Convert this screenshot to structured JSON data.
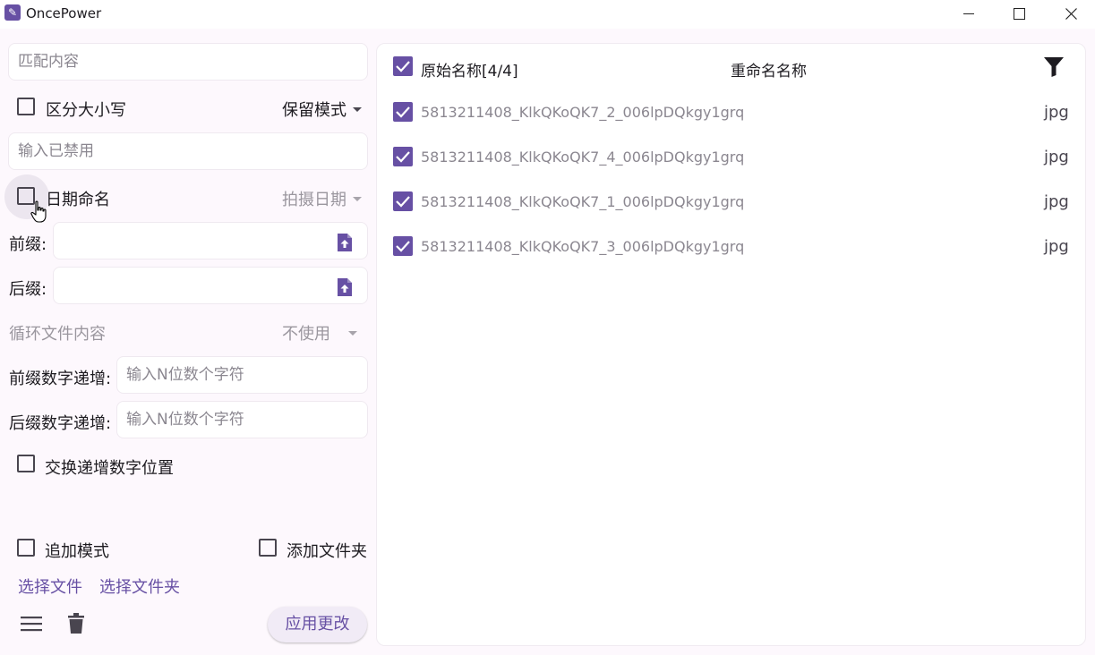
{
  "window": {
    "title": "OncePower"
  },
  "left": {
    "match_placeholder": "匹配内容",
    "case_sensitive_label": "区分大小写",
    "case_sensitive_checked": false,
    "mode_dropdown": "保留模式",
    "input_disabled_placeholder": "输入已禁用",
    "date_rename_label": "日期命名",
    "date_rename_checked": false,
    "date_dropdown": "拍摄日期",
    "prefix_label": "前缀:",
    "suffix_label": "后缀:",
    "loop_file_label": "循环文件内容",
    "loop_dropdown": "不使用",
    "prefix_increment_label": "前缀数字递增:",
    "prefix_increment_placeholder": "输入N位数个字符",
    "suffix_increment_label": "后缀数字递增:",
    "suffix_increment_placeholder": "输入N位数个字符",
    "swap_label": "交换递增数字位置",
    "append_mode_label": "追加模式",
    "add_folder_label": "添加文件夹",
    "select_files_link": "选择文件",
    "select_folder_link": "选择文件夹",
    "apply_button": "应用更改"
  },
  "right": {
    "header_original": "原始名称[4/4]",
    "header_rename": "重命名名称",
    "files": [
      {
        "name": "5813211408_KlkQKoQK7_2_006lpDQkgy1grq",
        "ext": "jpg",
        "checked": true
      },
      {
        "name": "5813211408_KlkQKoQK7_4_006lpDQkgy1grq",
        "ext": "jpg",
        "checked": true
      },
      {
        "name": "5813211408_KlkQKoQK7_1_006lpDQkgy1grq",
        "ext": "jpg",
        "checked": true
      },
      {
        "name": "5813211408_KlkQKoQK7_3_006lpDQkgy1grq",
        "ext": "jpg",
        "checked": true
      }
    ]
  },
  "colors": {
    "accent": "#6750a4",
    "background": "#fdf8fd"
  },
  "icons": [
    "app-icon",
    "filter-icon",
    "upload-file-icon",
    "menu-icon",
    "trash-icon",
    "check-icon",
    "cursor-hand-icon"
  ]
}
